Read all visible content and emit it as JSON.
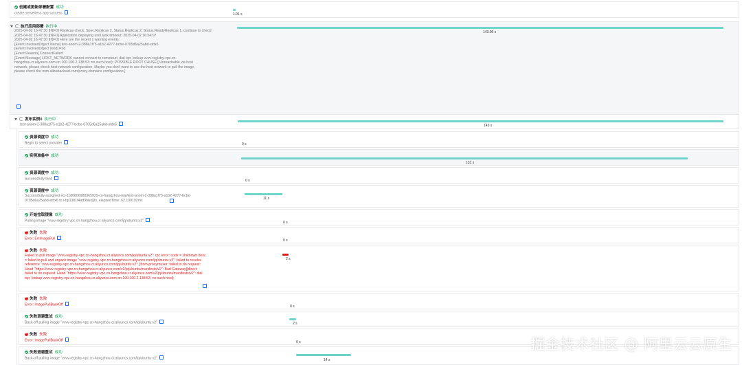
{
  "rows": [
    {
      "name": "创建或更新部署配置",
      "status": "成功",
      "message": "create serverless app success",
      "duration": "1.01 s"
    },
    {
      "name": "执行应用部署",
      "status": "执行中",
      "message": "2025-04-02 16:47:30 [INFO] Replicas check, Spec.Replicas 2, Status.Replicas 2, Status.ReadyReplicas 1, continue to check!\n2025-04-02 16:47:30 [INFO] Application deploying until task timeout: 2025-04-02 16:54:07\n2025-04-02 16:47:30 [INFO] Here are the recent 1 warning events:\n[Event InvolvedObject Name] test-anom-2-388a1f75-a1b2-4277-bcbe-0705d6a25abd-stdx6\n[Event InvolvedObject Kind] Pod\n[Event Reason] ConnectFailed\n[Event Message] HOST_NETWORK cannot connect to remoteuri: dial tcp: lookup vvvv-registry-vpc.cn-\nhangzhou.cr.aliyuncs.com on 100.100.2.138:53: no such host); POSSIBLE ROOT CAUSE:[ Unreachable via host\nnetwork, please check host network configuration. Maybe you don't want to use the host network to pull the image,\nplease check the nsm.alibabacloud.com/proxy-domains configuration ]",
      "duration": "143.06 s"
    },
    {
      "name": "发布实例0",
      "status": "执行中",
      "message": "test-anom-2-388a1f75-a1b2-4277-bcbe-0705d6a25abd-stdx6",
      "duration": "143 s"
    },
    {
      "name": "资源调度中",
      "status": "成功",
      "message": "Begin to select provider",
      "duration": "0 s"
    },
    {
      "name": "实例准备中",
      "status": "成功",
      "message": "",
      "duration": "131 s"
    },
    {
      "name": "资源调度中",
      "status": "成功",
      "message": "Successfully bind",
      "duration": "0 s"
    },
    {
      "name": "资源调度中",
      "status": "成功",
      "message": "Successfully assigned eci-1180806988365929-cn-hangzhou-mai/test-anom-2-388a1f75-a1b2-4277-bcbe-\n0705d6a25abd-stdx6 to i-bp13b1f4ad3hlsdj2v, elapsedTime: 62.130192ms",
      "duration": "11 s"
    },
    {
      "name": "开始拉取镜像",
      "status": "成功",
      "message": "Pulling image \"vvvv-registry-vpc.cn-hangzhou.cr.aliyuncs.com/jq/ubuntu:v2\"",
      "duration": "0 s"
    },
    {
      "name": "失败",
      "status": "失败",
      "message": "Error: ErrImagePull",
      "duration": "0 s"
    },
    {
      "name": "失败",
      "status": "失败",
      "message": "Failed to pull image \"vvvv-registry-vpc.cn-hangzhou.cr.aliyuncs.com/jq/ubuntu:v2\": rpc error: code = Unknown desc\n= failed to pull and unpack image \"vvvv-registry-vpc.cn-hangzhou.cr.aliyuncs.com/jq/ubuntu:v2\": failed to resolve\nreference \"vvvv-registry-vpc.cn-hangzhou.cr.aliyuncs.com/jq/ubuntu:v2\": [from-proxymuxer: failed to do request:\nHead \"https://vvvv-registry-vpc.cn-hangzhou.cr.aliyuncs.com/v2/jq/ubuntu/manifests/v2\": Bad Gateway][direct:\nfailed to do request: Head \"https://vvvv-registry-vpc.cn-hangzhou.cr.aliyuncs.com/v2/jq/ubuntu/manifests/v2\": dial\ntcp: lookup vvvv-registry-vpc.cn-hangzhou.cr.aliyuncs.com on 100.100.2.138:53: no such host]",
      "duration": "2 s"
    },
    {
      "name": "失败",
      "status": "失败",
      "message": "Error: ImagePullBackOff",
      "duration": "0 s"
    },
    {
      "name": "失败退避重试",
      "status": "成功",
      "message": "Back-off pulling image \"vvvv-registry-vpc.cn-hangzhou.cr.aliyuncs.com/jq/ubuntu:v2\"",
      "duration": "2 s"
    },
    {
      "name": "失败",
      "status": "失败",
      "message": "Error: ImagePullBackOff",
      "duration": "0 s"
    },
    {
      "name": "失败退避重试",
      "status": "成功",
      "message": "Back-off pulling image \"vvvv-registry-vpc.cn-hangzhou.cr.aliyuncs.com/jq/ubuntu:v2\"",
      "duration": "14 s"
    }
  ],
  "watermark": "掘金技术社区 @ 阿里云云原生",
  "colors": {
    "success": "#18a058",
    "failure": "#e02020",
    "bar": "#6fd5cc",
    "link": "#1b6ef3"
  }
}
